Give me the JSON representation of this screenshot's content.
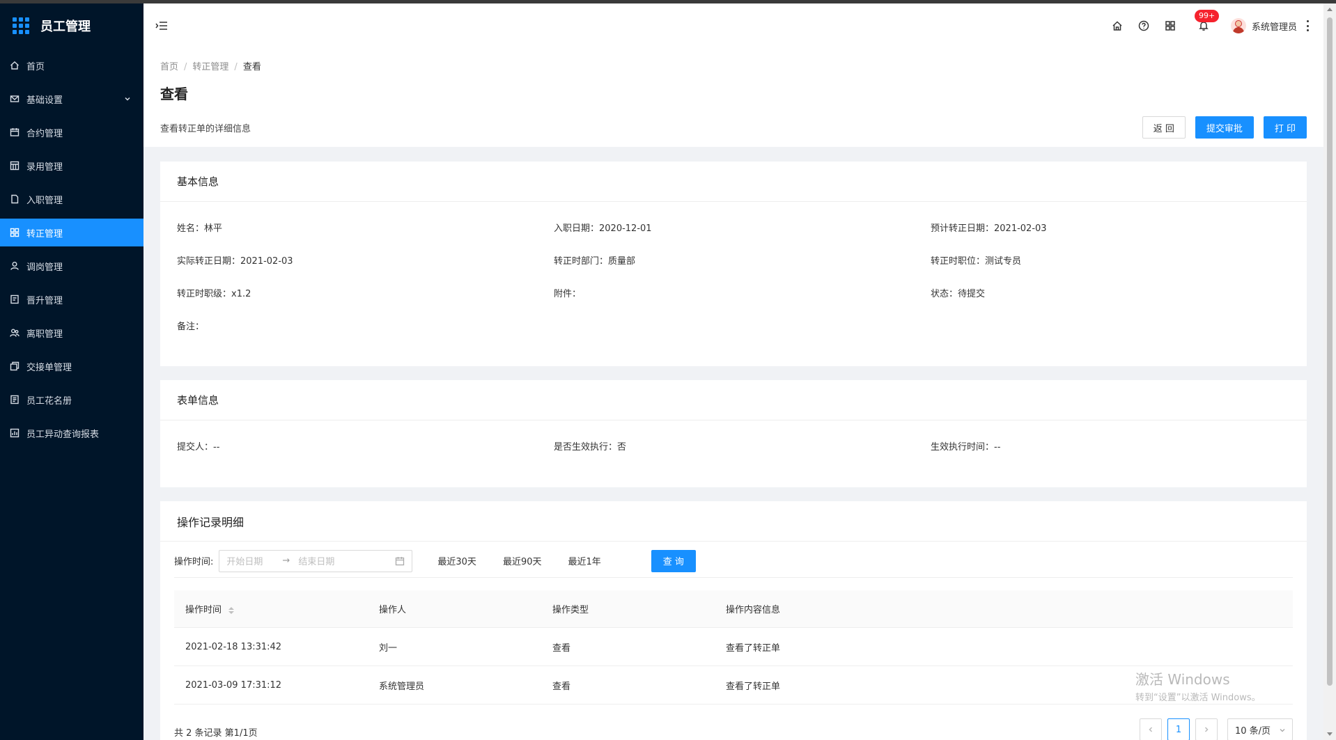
{
  "app": {
    "title": "员工管理"
  },
  "sidebar": {
    "items": [
      {
        "label": "首页",
        "icon": "home-icon"
      },
      {
        "label": "基础设置",
        "icon": "mail-icon",
        "expandable": true
      },
      {
        "label": "合约管理",
        "icon": "calendar-icon"
      },
      {
        "label": "录用管理",
        "icon": "table-icon"
      },
      {
        "label": "入职管理",
        "icon": "file-icon"
      },
      {
        "label": "转正管理",
        "icon": "grid-icon",
        "active": true
      },
      {
        "label": "调岗管理",
        "icon": "user-icon"
      },
      {
        "label": "晋升管理",
        "icon": "form-icon"
      },
      {
        "label": "离职管理",
        "icon": "team-icon"
      },
      {
        "label": "交接单管理",
        "icon": "copy-icon"
      },
      {
        "label": "员工花名册",
        "icon": "book-icon"
      },
      {
        "label": "员工异动查询报表",
        "icon": "report-icon"
      }
    ]
  },
  "header": {
    "badge": "99+",
    "user_name": "系统管理员"
  },
  "breadcrumb": {
    "home": "首页",
    "parent": "转正管理",
    "current": "查看",
    "sep": "/"
  },
  "page": {
    "title": "查看",
    "description": "查看转正单的详细信息",
    "back_label": "返 回",
    "submit_label": "提交审批",
    "print_label": "打 印"
  },
  "basic": {
    "title": "基本信息",
    "name": "姓名：林平",
    "entry_date": "入职日期：2020-12-01",
    "expected_date": "预计转正日期：2021-02-03",
    "actual_date": "实际转正日期：2021-02-03",
    "department": "转正时部门：质量部",
    "position": "转正时职位：测试专员",
    "level": "转正时职级：x1.2",
    "attachment": "附件：",
    "status": "状态：待提交",
    "remark": "备注："
  },
  "form_info": {
    "title": "表单信息",
    "submitter": "提交人：--",
    "effective": "是否生效执行：否",
    "effective_time": "生效执行时间：--"
  },
  "records": {
    "title": "操作记录明细",
    "filter_label": "操作时间:",
    "start_placeholder": "开始日期",
    "range_arrow": "→",
    "end_placeholder": "结束日期",
    "quick": [
      "最近30天",
      "最近90天",
      "最近1年"
    ],
    "query_label": "查 询",
    "columns": [
      "操作时间",
      "操作人",
      "操作类型",
      "操作内容信息"
    ],
    "rows": [
      [
        "2021-02-18 13:31:42",
        "刘一",
        "查看",
        "查看了转正单"
      ],
      [
        "2021-03-09 17:31:12",
        "系统管理员",
        "查看",
        "查看了转正单"
      ]
    ],
    "total": "共 2 条记录 第1/1页",
    "current_page": "1",
    "page_size": "10 条/页"
  },
  "watermark": {
    "line1": "激活 Windows",
    "line2": "转到“设置”以激活 Windows。"
  },
  "colors": {
    "primary": "#1890ff",
    "sidebar_bg": "#001529",
    "badge": "#f5222d"
  }
}
